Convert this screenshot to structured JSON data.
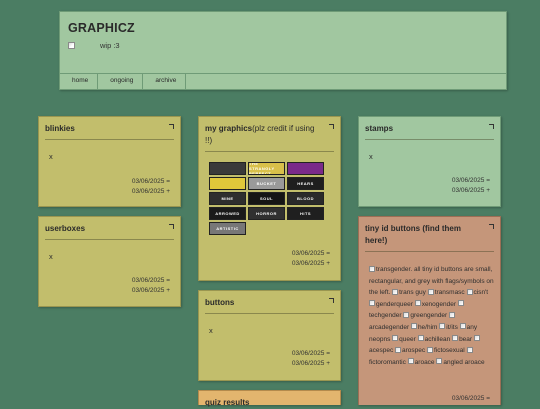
{
  "header": {
    "title": "GRAPHICZ",
    "status_text": "wip :3",
    "nav": [
      "home",
      "ongoing",
      "archive"
    ]
  },
  "cards": {
    "blinkies": {
      "title": "blinkies",
      "body": "x",
      "created": "03/06/2025 =",
      "updated": "03/06/2025 +"
    },
    "userboxes": {
      "title": "userboxes",
      "body": "x",
      "created": "03/06/2025 =",
      "updated": "03/06/2025 +"
    },
    "my_graphics": {
      "title": "my graphics",
      "title_note": "(plz credit if using !!)",
      "created": "03/06/2025 =",
      "updated": "03/06/2025 +",
      "buttons": [
        {
          "label": "",
          "bg": "#3a3a3a"
        },
        {
          "label": "THE STRANGLY PERFECT",
          "bg": "#d8c04a"
        },
        {
          "label": "",
          "bg": "#7a2a8a"
        },
        {
          "label": "",
          "bg": "#e0c83a"
        },
        {
          "label": "BUCKET",
          "bg": "#9a9a9a"
        },
        {
          "label": "HEARS",
          "bg": "#1e1e1e"
        },
        {
          "label": "MINE",
          "bg": "#2e2e2e"
        },
        {
          "label": "SOUL",
          "bg": "#151515"
        },
        {
          "label": "BLOOD",
          "bg": "#2a2a2a"
        },
        {
          "label": "ARROWED",
          "bg": "#1a1a1a"
        },
        {
          "label": "HORROR",
          "bg": "#303030"
        },
        {
          "label": "HITS",
          "bg": "#1f1f1f"
        },
        {
          "label": "ARTISTIC",
          "bg": "#777777"
        }
      ]
    },
    "buttons": {
      "title": "buttons",
      "body": "x",
      "created": "03/06/2025 =",
      "updated": "03/06/2025 +"
    },
    "quiz": {
      "title": "quiz results"
    },
    "stamps": {
      "title": "stamps",
      "body": "x",
      "created": "03/06/2025 =",
      "updated": "03/06/2025 +"
    },
    "tiny_id": {
      "title": "tiny id buttons (find them here!)",
      "intro": "transgender. all tiny id buttons are small, rectangular, and grey with flags/symbols on the left.",
      "items": [
        "trans guy",
        "transmasc",
        "cisn't",
        "genderqueer",
        "xenogender",
        "techgender",
        "greengender",
        "arcadegender",
        "he/him",
        "it/its",
        "any neopns",
        "queer",
        "achillean",
        "bear",
        "acespec",
        "arospec",
        "fictosexual",
        "fictoromantic",
        "aroace",
        "angled aroace"
      ],
      "created": "03/06/2025 ="
    }
  }
}
